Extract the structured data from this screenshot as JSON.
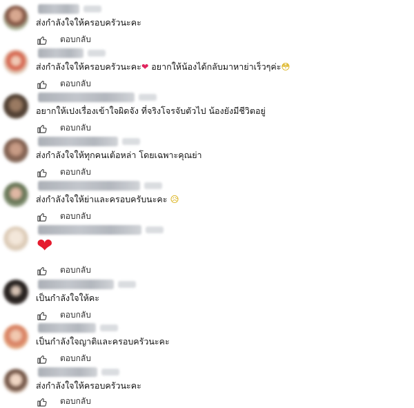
{
  "comments": [
    {
      "text": "ส่งกำลังใจให้ครอบครัวนะคะ"
    },
    {
      "text": "ส่งกำลังใจให้ครอบครัวนะคะ",
      "text_tail": " อยากให้น้องได้กลับมาหาย่าเร็วๆค่ะ",
      "emoji": "❤",
      "emoji2": "😳"
    },
    {
      "text": "อยากให้เปงเรื่องเข้าใจผิดจัง ที่จริงโจรจับตัวไป น้องยังมีชีวิตอยู่"
    },
    {
      "text": "ส่งกำลังใจให้ทุกคนเต้อหล่า โดยเฉพาะคุณย่า"
    },
    {
      "text": "ส่งกำลังใจให้ย่าและครอบครับนะคะ",
      "emoji2": "😥"
    },
    {
      "emoji_big": "❤"
    },
    {
      "text": "เป็นกำลังใจให้คะ"
    },
    {
      "text": "เป็นกำลังใจญาติและครอบครัวนะคะ"
    },
    {
      "text": "ส่งกำลังใจให้ครอบครัวนะคะ"
    }
  ],
  "reply_label": "ตอบกลับ",
  "icons": {
    "like": "thumbs-up-icon"
  }
}
